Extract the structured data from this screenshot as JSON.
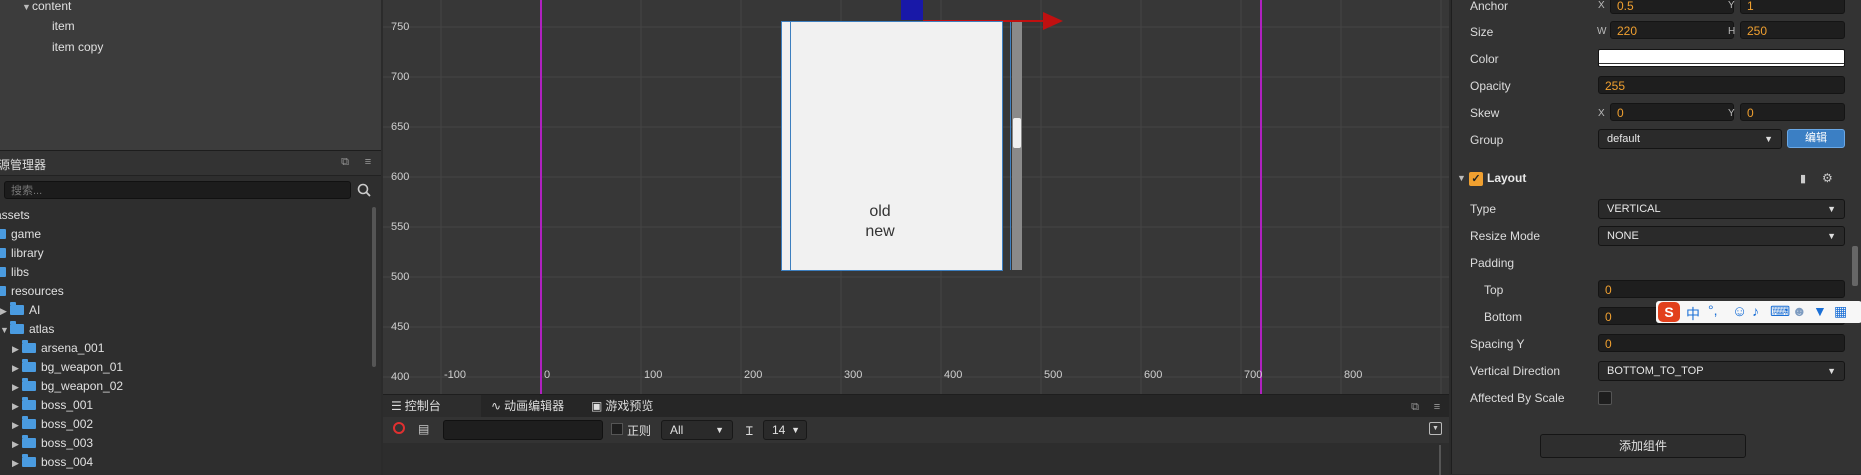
{
  "hierarchy": {
    "rows": [
      {
        "label": "content",
        "expanded": true
      },
      {
        "label": "item"
      },
      {
        "label": "item copy"
      }
    ]
  },
  "assets": {
    "title": "资源管理器",
    "search_placeholder": "搜索...",
    "tree": [
      {
        "label": "assets"
      },
      {
        "label": "game"
      },
      {
        "label": "library"
      },
      {
        "label": "libs"
      },
      {
        "label": "resources"
      },
      {
        "label": "AI"
      },
      {
        "label": "atlas"
      },
      {
        "label": "arsena_001"
      },
      {
        "label": "bg_weapon_01"
      },
      {
        "label": "bg_weapon_02"
      },
      {
        "label": "boss_001"
      },
      {
        "label": "boss_002"
      },
      {
        "label": "boss_003"
      },
      {
        "label": "boss_004"
      }
    ]
  },
  "scene": {
    "y_labels": [
      "750",
      "700",
      "650",
      "600",
      "550",
      "500",
      "450",
      "400"
    ],
    "x_labels": [
      "-100",
      "0",
      "100",
      "200",
      "300",
      "400",
      "500",
      "600",
      "700",
      "800"
    ],
    "node_text": {
      "line1": "old",
      "line2": "new"
    },
    "colors": {
      "background": "#373737",
      "grid": "#454545",
      "origin_line": "#b020c0",
      "panel": "#f1f1f1"
    }
  },
  "console": {
    "tabs": [
      {
        "label": "控制台",
        "active": true
      },
      {
        "label": "动画编辑器"
      },
      {
        "label": "游戏预览"
      }
    ],
    "regex_label": "正则",
    "level_select": "All",
    "font_size": "14"
  },
  "inspector": {
    "anchor": {
      "label": "Anchor",
      "x": "0.5",
      "y": "1"
    },
    "size": {
      "label": "Size",
      "w": "220",
      "h": "250"
    },
    "color": {
      "label": "Color",
      "value": "#ffffff"
    },
    "opacity": {
      "label": "Opacity",
      "value": "255"
    },
    "skew": {
      "label": "Skew",
      "x": "0",
      "y": "0"
    },
    "group": {
      "label": "Group",
      "value": "default",
      "edit_label": "编辑"
    },
    "layout": {
      "title": "Layout",
      "enabled": true,
      "type": {
        "label": "Type",
        "value": "VERTICAL"
      },
      "resize_mode": {
        "label": "Resize Mode",
        "value": "NONE"
      },
      "padding": {
        "label": "Padding"
      },
      "top": {
        "label": "Top",
        "value": "0"
      },
      "bottom": {
        "label": "Bottom",
        "value": "0"
      },
      "spacing_y": {
        "label": "Spacing Y",
        "value": "0"
      },
      "vertical_direction": {
        "label": "Vertical Direction",
        "value": "BOTTOM_TO_TOP"
      },
      "affected_by_scale": {
        "label": "Affected By Scale",
        "checked": false
      }
    },
    "add_component_label": "添加组件",
    "xy_labels": {
      "x": "X",
      "y": "Y",
      "w": "W",
      "h": "H"
    }
  },
  "ime_toolbar": {
    "logo": "S",
    "chinese": "中",
    "punct": "°,"
  }
}
